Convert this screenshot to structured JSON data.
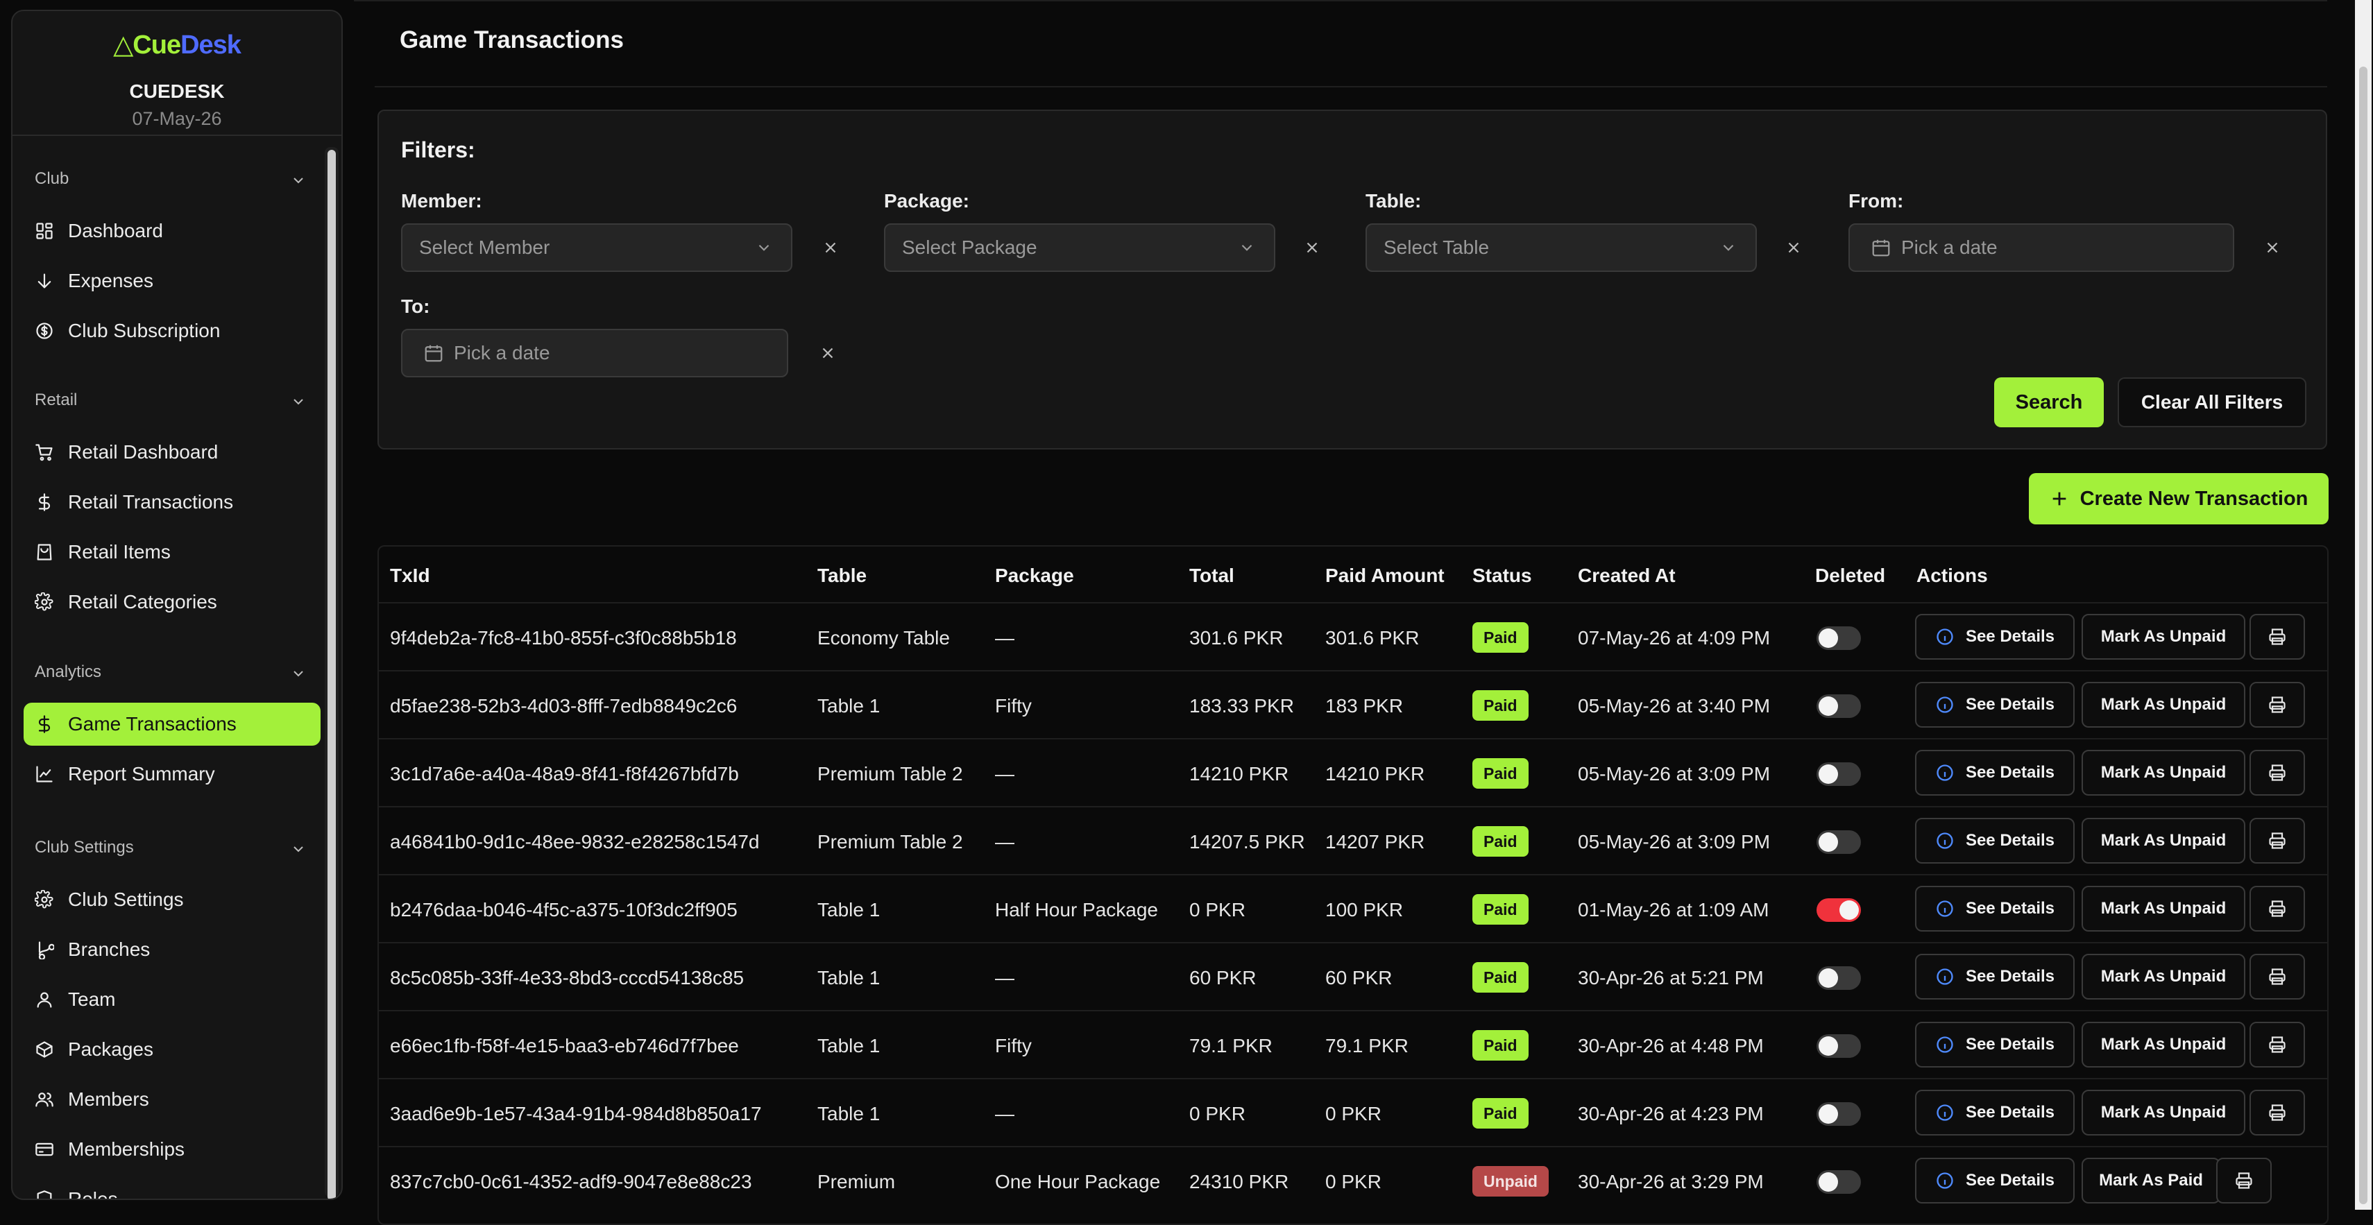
{
  "brand": {
    "logo_cue": "Cue",
    "logo_desk": "Desk",
    "club_name": "CUEDESK",
    "date": "07-May-26"
  },
  "sidebar": {
    "groups": [
      {
        "label": "Club",
        "items": [
          {
            "label": "Dashboard",
            "icon": "dashboard-icon"
          },
          {
            "label": "Expenses",
            "icon": "arrow-down-icon"
          },
          {
            "label": "Club Subscription",
            "icon": "dollar-circle-icon"
          }
        ]
      },
      {
        "label": "Retail",
        "items": [
          {
            "label": "Retail Dashboard",
            "icon": "cart-icon"
          },
          {
            "label": "Retail Transactions",
            "icon": "dollar-icon"
          },
          {
            "label": "Retail Items",
            "icon": "shopping-bag-icon"
          },
          {
            "label": "Retail Categories",
            "icon": "gear-icon"
          }
        ]
      },
      {
        "label": "Analytics",
        "items": [
          {
            "label": "Game Transactions",
            "icon": "dollar-icon",
            "active": true
          },
          {
            "label": "Report Summary",
            "icon": "chart-line-icon"
          }
        ]
      },
      {
        "label": "Club Settings",
        "items": [
          {
            "label": "Club Settings",
            "icon": "gear-icon"
          },
          {
            "label": "Branches",
            "icon": "branch-icon"
          },
          {
            "label": "Team",
            "icon": "user-icon"
          },
          {
            "label": "Packages",
            "icon": "package-icon"
          },
          {
            "label": "Members",
            "icon": "users-icon"
          },
          {
            "label": "Memberships",
            "icon": "card-icon"
          },
          {
            "label": "Roles",
            "icon": "shield-icon"
          }
        ]
      }
    ]
  },
  "page": {
    "title": "Game Transactions"
  },
  "filters": {
    "title": "Filters:",
    "member": {
      "label": "Member:",
      "placeholder": "Select Member"
    },
    "package": {
      "label": "Package:",
      "placeholder": "Select Package"
    },
    "table": {
      "label": "Table:",
      "placeholder": "Select Table"
    },
    "from": {
      "label": "From:",
      "placeholder": "Pick a date"
    },
    "to": {
      "label": "To:",
      "placeholder": "Pick a date"
    },
    "search_label": "Search",
    "clear_label": "Clear All Filters"
  },
  "create_label": "Create New Transaction",
  "table": {
    "columns": [
      "TxId",
      "Table",
      "Package",
      "Total",
      "Paid Amount",
      "Status",
      "Created At",
      "Deleted",
      "Actions"
    ],
    "action_labels": {
      "details": "See Details",
      "unpaid": "Mark As Unpaid",
      "paid": "Mark As Paid"
    },
    "rows": [
      {
        "txid": "9f4deb2a-7fc8-41b0-855f-c3f0c88b5b18",
        "table": "Economy Table",
        "package": "—",
        "total": "301.6 PKR",
        "paid": "301.6 PKR",
        "status": "Paid",
        "created": "07-May-26 at 4:09 PM",
        "deleted": false
      },
      {
        "txid": "d5fae238-52b3-4d03-8fff-7edb8849c2c6",
        "table": "Table 1",
        "package": "Fifty",
        "total": "183.33 PKR",
        "paid": "183 PKR",
        "status": "Paid",
        "created": "05-May-26 at 3:40 PM",
        "deleted": false
      },
      {
        "txid": "3c1d7a6e-a40a-48a9-8f41-f8f4267bfd7b",
        "table": "Premium Table 2",
        "package": "—",
        "total": "14210 PKR",
        "paid": "14210 PKR",
        "status": "Paid",
        "created": "05-May-26 at 3:09 PM",
        "deleted": false
      },
      {
        "txid": "a46841b0-9d1c-48ee-9832-e28258c1547d",
        "table": "Premium Table 2",
        "package": "—",
        "total": "14207.5 PKR",
        "paid": "14207 PKR",
        "status": "Paid",
        "created": "05-May-26 at 3:09 PM",
        "deleted": false
      },
      {
        "txid": "b2476daa-b046-4f5c-a375-10f3dc2ff905",
        "table": "Table 1",
        "package": "Half Hour Package",
        "total": "0 PKR",
        "paid": "100 PKR",
        "status": "Paid",
        "created": "01-May-26 at 1:09 AM",
        "deleted": true
      },
      {
        "txid": "8c5c085b-33ff-4e33-8bd3-cccd54138c85",
        "table": "Table 1",
        "package": "—",
        "total": "60 PKR",
        "paid": "60 PKR",
        "status": "Paid",
        "created": "30-Apr-26 at 5:21 PM",
        "deleted": false
      },
      {
        "txid": "e66ec1fb-f58f-4e15-baa3-eb746d7f7bee",
        "table": "Table 1",
        "package": "Fifty",
        "total": "79.1 PKR",
        "paid": "79.1 PKR",
        "status": "Paid",
        "created": "30-Apr-26 at 4:48 PM",
        "deleted": false
      },
      {
        "txid": "3aad6e9b-1e57-43a4-91b4-984d8b850a17",
        "table": "Table 1",
        "package": "—",
        "total": "0 PKR",
        "paid": "0 PKR",
        "status": "Paid",
        "created": "30-Apr-26 at 4:23 PM",
        "deleted": false
      },
      {
        "txid": "837c7cb0-0c61-4352-adf9-9047e8e88c23",
        "table": "Premium",
        "package": "One Hour Package",
        "total": "24310 PKR",
        "paid": "0 PKR",
        "status": "Unpaid",
        "created": "30-Apr-26 at 3:29 PM",
        "deleted": false
      }
    ]
  },
  "colors": {
    "accent": "#a3f03a",
    "brand_blue": "#4f6bff",
    "danger": "#f0323c",
    "unpaid": "#b54848"
  }
}
